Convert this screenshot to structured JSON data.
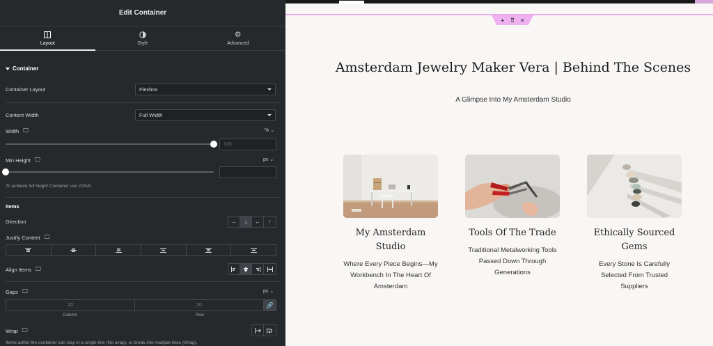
{
  "panel": {
    "title": "Edit Container",
    "tabs": [
      {
        "label": "Layout",
        "icon": "layout-icon"
      },
      {
        "label": "Style",
        "icon": "style-half-circle-icon"
      },
      {
        "label": "Advanced",
        "icon": "gear-icon"
      }
    ],
    "section": "Container",
    "container_layout": {
      "label": "Container Layout",
      "value": "Flexbox"
    },
    "content_width": {
      "label": "Content Width",
      "value": "Full Width"
    },
    "width": {
      "label": "Width",
      "unit": "%",
      "value": "100",
      "level": 100
    },
    "min_height": {
      "label": "Min Height",
      "unit": "px",
      "value": "",
      "level": 0,
      "hint": "To achieve full height Container use 100vh."
    },
    "items_heading": "Items",
    "direction": {
      "label": "Direction",
      "options": [
        "→",
        "↓",
        "←",
        "↑"
      ],
      "selected": 1
    },
    "justify_content": {
      "label": "Justify Content"
    },
    "align_items": {
      "label": "Align Items"
    },
    "gaps": {
      "label": "Gaps",
      "unit": "px",
      "column": "20",
      "row": "20",
      "column_label": "Column",
      "row_label": "Row"
    },
    "wrap": {
      "label": "Wrap",
      "hint": "Items within the container can stay in a single line (No wrap), or break into multiple lines (Wrap)."
    }
  },
  "handle": {
    "add": "+",
    "move": "⠿",
    "close": "×"
  },
  "page": {
    "title": "Amsterdam Jewelry Maker Vera | Behind The Scenes",
    "subtitle": "A Glimpse Into My Amsterdam Studio",
    "cards": [
      {
        "title": "My Amsterdam Studio",
        "desc": "Where Every Piece Begins—My Workbench In The Heart Of Amsterdam"
      },
      {
        "title": "Tools Of The Trade",
        "desc": "Traditional Metalworking Tools Passed Down Through Generations"
      },
      {
        "title": "Ethically Sourced Gems",
        "desc": "Every Stone Is Carefully Selected From Trusted Suppliers"
      }
    ]
  },
  "colors": {
    "panel_bg": "#26292c",
    "accent_pink": "#e9a8ea",
    "canvas_bg": "#f9f7f5"
  }
}
